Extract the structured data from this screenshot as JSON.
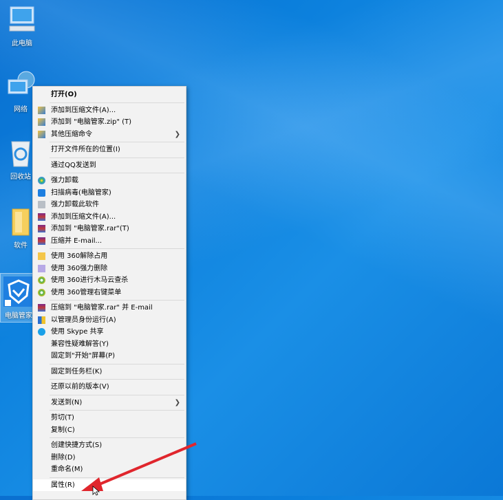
{
  "desktop": {
    "icons": [
      {
        "label": "此电脑"
      },
      {
        "label": "网络"
      },
      {
        "label": "回收站"
      },
      {
        "label": "软件"
      },
      {
        "label": "电脑管家"
      }
    ]
  },
  "menu": {
    "items": [
      {
        "label": "打开(O)"
      },
      {
        "label": "添加到压缩文件(A)..."
      },
      {
        "label": "添加到 \"电脑管家.zip\" (T)"
      },
      {
        "label": "其他压缩命令"
      },
      {
        "label": "打开文件所在的位置(I)"
      },
      {
        "label": "通过QQ发送到"
      },
      {
        "label": "强力卸载"
      },
      {
        "label": "扫描病毒(电脑管家)"
      },
      {
        "label": "强力卸载此软件"
      },
      {
        "label": "添加到压缩文件(A)..."
      },
      {
        "label": "添加到 \"电脑管家.rar\"(T)"
      },
      {
        "label": "压缩并 E-mail..."
      },
      {
        "label": "使用 360解除占用"
      },
      {
        "label": "使用 360强力删除"
      },
      {
        "label": "使用 360进行木马云查杀"
      },
      {
        "label": "使用 360管理右键菜单"
      },
      {
        "label": "压缩到 \"电脑管家.rar\" 并 E-mail"
      },
      {
        "label": "以管理员身份运行(A)"
      },
      {
        "label": "使用 Skype 共享"
      },
      {
        "label": "兼容性疑难解答(Y)"
      },
      {
        "label": "固定到\"开始\"屏幕(P)"
      },
      {
        "label": "固定到任务栏(K)"
      },
      {
        "label": "还原以前的版本(V)"
      },
      {
        "label": "发送到(N)"
      },
      {
        "label": "剪切(T)"
      },
      {
        "label": "复制(C)"
      },
      {
        "label": "创建快捷方式(S)"
      },
      {
        "label": "删除(D)"
      },
      {
        "label": "重命名(M)"
      },
      {
        "label": "属性(R)"
      }
    ]
  },
  "colors": {
    "desktop": "#0b7fdc",
    "menu_bg": "#f2f2f2",
    "arrow": "#e0262d"
  }
}
